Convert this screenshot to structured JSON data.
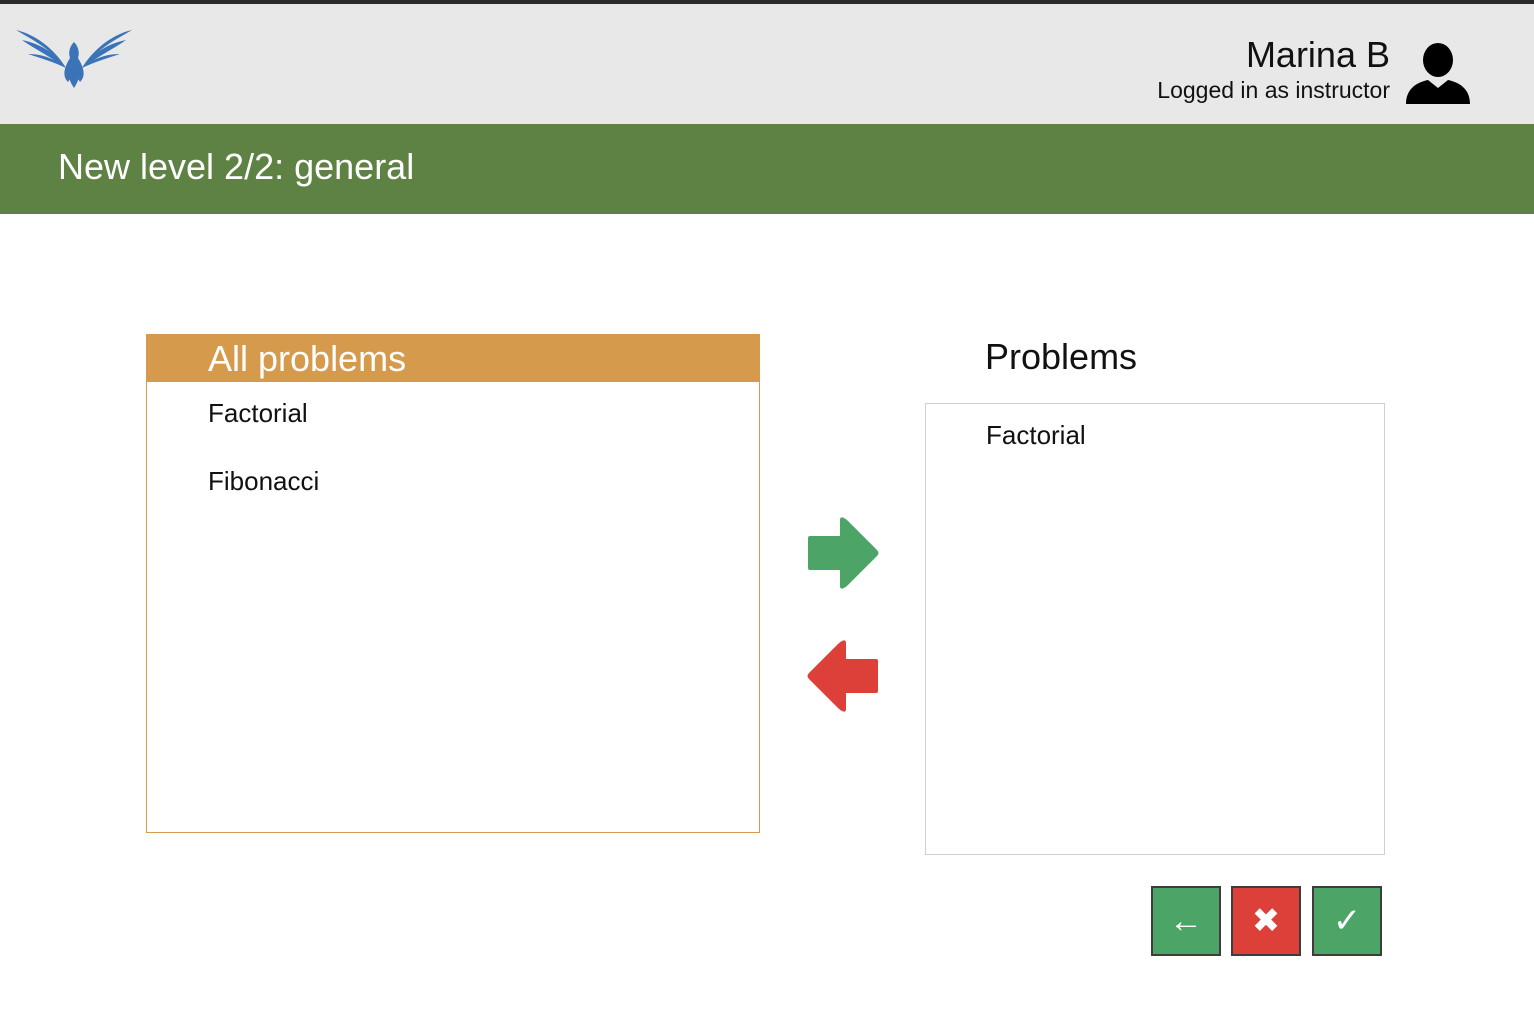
{
  "header": {
    "logo": "phoenix-logo",
    "user_name": "Marina B",
    "user_role": "Logged in as instructor",
    "avatar_icon": "user-icon"
  },
  "page": {
    "title": "New level 2/2: general"
  },
  "all_problems": {
    "heading": "All problems",
    "items": [
      "Factorial",
      "Fibonacci"
    ]
  },
  "selected_problems": {
    "heading": "Problems",
    "items": [
      "Factorial"
    ]
  },
  "transfer": {
    "add_icon": "arrow-right-icon",
    "remove_icon": "arrow-left-icon"
  },
  "actions": {
    "back_label": "←",
    "cancel_label": "✖",
    "confirm_label": "✓"
  },
  "colors": {
    "header_bg": "#e8e8e8",
    "title_bar": "#5e8144",
    "panel_accent": "#d69a4c",
    "green": "#4ca567",
    "red": "#dc4038",
    "logo_blue": "#3a73b8"
  }
}
